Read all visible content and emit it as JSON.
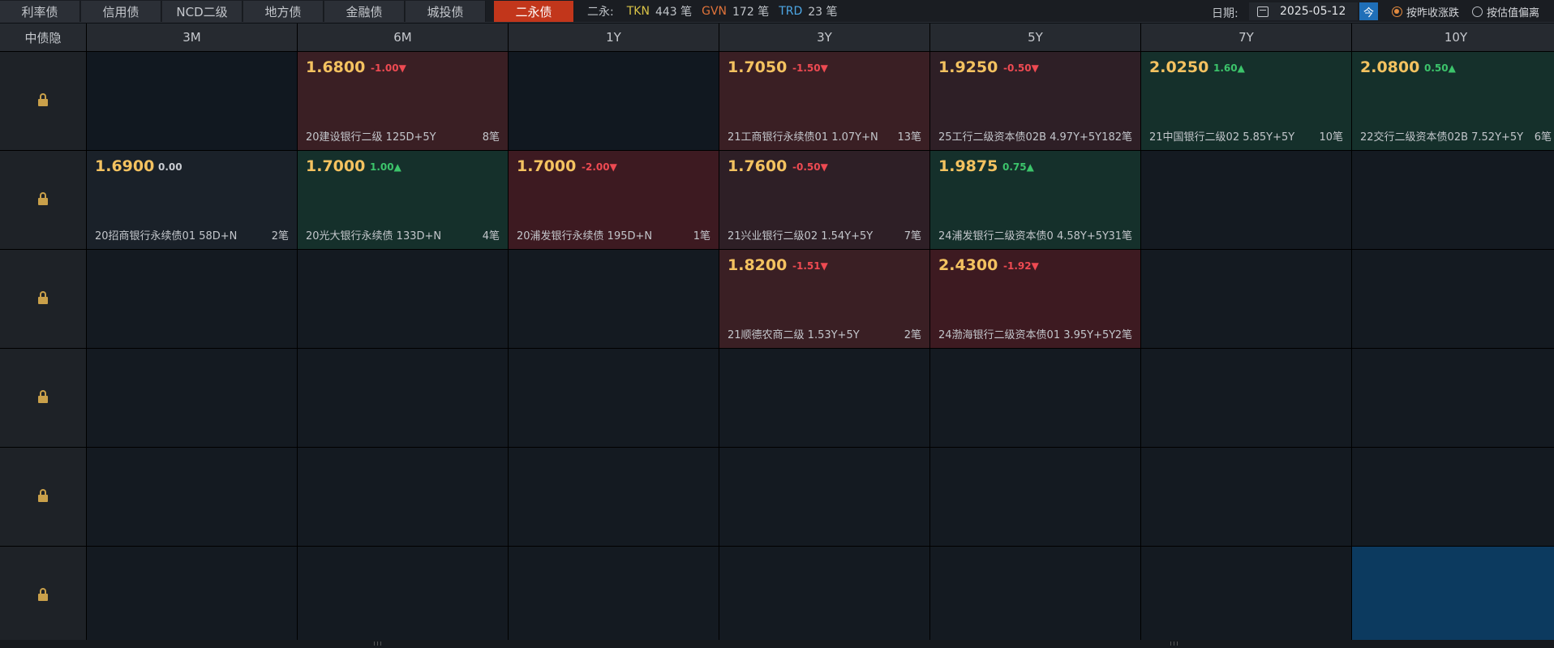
{
  "tabs": [
    {
      "label": "利率债",
      "active": false
    },
    {
      "label": "信用债",
      "active": false
    },
    {
      "label": "NCD二级",
      "active": false
    },
    {
      "label": "地方债",
      "active": false
    },
    {
      "label": "金融债",
      "active": false
    },
    {
      "label": "城投债",
      "active": false
    },
    {
      "label": "二永债",
      "active": true
    }
  ],
  "stats": {
    "label": "二永:",
    "tkn_tag": "TKN",
    "tkn_count": "443 笔",
    "gvn_tag": "GVN",
    "gvn_count": "172 笔",
    "trd_tag": "TRD",
    "trd_count": "23 笔"
  },
  "date": {
    "label": "日期:",
    "value": "2025-05-12",
    "today_button": "今"
  },
  "options": [
    {
      "label": "按昨收涨跌",
      "selected": true
    },
    {
      "label": "按估值偏离",
      "selected": false
    }
  ],
  "grid": {
    "corner_label": "中债隐",
    "columns": [
      "3M",
      "6M",
      "1Y",
      "3Y",
      "5Y",
      "7Y",
      "10Y"
    ],
    "cells": {
      "r0c1": {
        "price": "1.6800",
        "change": "-1.00▼",
        "bond": "20建设银行二级 125D+5Y",
        "count": "8笔"
      },
      "r0c3": {
        "price": "1.7050",
        "change": "-1.50▼",
        "bond": "21工商银行永续债01 1.07Y+N",
        "count": "13笔"
      },
      "r0c4": {
        "price": "1.9250",
        "change": "-0.50▼",
        "bond": "25工行二级资本债02B 4.97Y+5Y",
        "count": "182笔"
      },
      "r0c5": {
        "price": "2.0250",
        "change": "1.60▲",
        "bond": "21中国银行二级02 5.85Y+5Y",
        "count": "10笔"
      },
      "r0c6": {
        "price": "2.0800",
        "change": "0.50▲",
        "bond": "22交行二级资本债02B 7.52Y+5Y",
        "count": "6笔"
      },
      "r1c0": {
        "price": "1.6900",
        "change": "0.00",
        "bond": "20招商银行永续债01 58D+N",
        "count": "2笔"
      },
      "r1c1": {
        "price": "1.7000",
        "change": "1.00▲",
        "bond": "20光大银行永续债 133D+N",
        "count": "4笔"
      },
      "r1c2": {
        "price": "1.7000",
        "change": "-2.00▼",
        "bond": "20浦发银行永续债 195D+N",
        "count": "1笔"
      },
      "r1c3": {
        "price": "1.7600",
        "change": "-0.50▼",
        "bond": "21兴业银行二级02 1.54Y+5Y",
        "count": "7笔"
      },
      "r1c4": {
        "price": "1.9875",
        "change": "0.75▲",
        "bond": "24浦发银行二级资本债0 4.58Y+5Y",
        "count": "31笔"
      },
      "r2c3": {
        "price": "1.8200",
        "change": "-1.51▼",
        "bond": "21顺德农商二级 1.53Y+5Y",
        "count": "2笔"
      },
      "r2c4": {
        "price": "2.4300",
        "change": "-1.92▼",
        "bond": "24渤海银行二级资本债01 3.95Y+5Y",
        "count": "2笔"
      }
    }
  }
}
